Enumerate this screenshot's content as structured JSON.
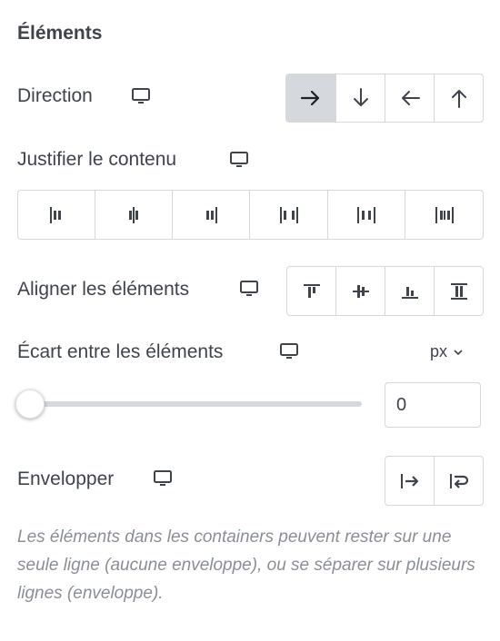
{
  "section": {
    "title": "Éléments"
  },
  "direction": {
    "label": "Direction",
    "device_icon": "desktop-icon",
    "options": [
      {
        "name": "row",
        "icon": "arrow-right-icon",
        "active": true
      },
      {
        "name": "column",
        "icon": "arrow-down-icon",
        "active": false
      },
      {
        "name": "row-reverse",
        "icon": "arrow-left-icon",
        "active": false
      },
      {
        "name": "column-reverse",
        "icon": "arrow-up-icon",
        "active": false
      }
    ]
  },
  "justify": {
    "label": "Justifier le contenu",
    "device_icon": "desktop-icon",
    "options": [
      {
        "name": "start",
        "icon": "justify-start-icon"
      },
      {
        "name": "center",
        "icon": "justify-center-icon"
      },
      {
        "name": "end",
        "icon": "justify-end-icon"
      },
      {
        "name": "space-between",
        "icon": "justify-space-between-icon"
      },
      {
        "name": "space-around",
        "icon": "justify-space-around-icon"
      },
      {
        "name": "space-evenly",
        "icon": "justify-space-evenly-icon"
      }
    ]
  },
  "align": {
    "label": "Aligner les éléments",
    "device_icon": "desktop-icon",
    "options": [
      {
        "name": "start",
        "icon": "align-start-icon"
      },
      {
        "name": "center",
        "icon": "align-center-icon"
      },
      {
        "name": "end",
        "icon": "align-end-icon"
      },
      {
        "name": "stretch",
        "icon": "align-stretch-icon"
      }
    ]
  },
  "gap": {
    "label": "Écart entre les éléments",
    "device_icon": "desktop-icon",
    "unit": "px",
    "value": "0",
    "slider_fraction": 0
  },
  "wrap": {
    "label": "Envelopper",
    "device_icon": "desktop-icon",
    "options": [
      {
        "name": "nowrap",
        "icon": "no-wrap-icon"
      },
      {
        "name": "wrap",
        "icon": "wrap-icon"
      }
    ]
  },
  "help_text": "Les éléments dans les containers peuvent rester sur une seule ligne (aucune enveloppe), ou se séparer sur plusieurs lignes (enveloppe).",
  "colors": {
    "text": "#3f444b",
    "border": "#d5d8dc",
    "active": "#d5d8dc",
    "help": "#8a8f96"
  }
}
